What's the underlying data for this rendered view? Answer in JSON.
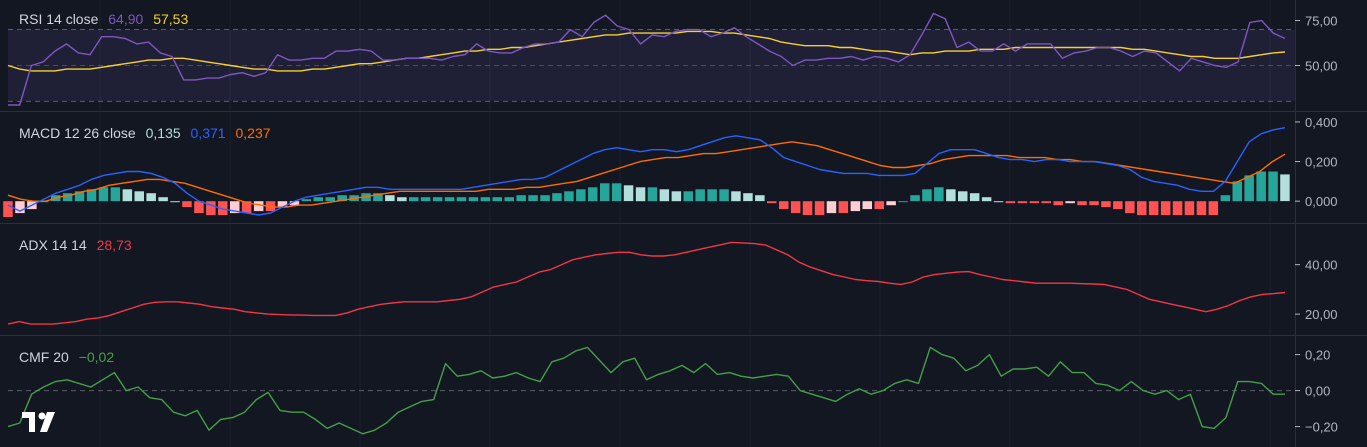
{
  "colors": {
    "background": "#131722",
    "grid": "#1e222d",
    "divider": "#2a2e39",
    "axis_text": "#b2b5be",
    "rsi": "#7e57c2",
    "rsi_ma": "#f5d033",
    "rsi_band": "#7e57c2",
    "macd": "#2962ff",
    "signal": "#ff6d00",
    "hist_pos_strong": "#26a69a",
    "hist_pos_weak": "#b2dfdb",
    "hist_neg_strong": "#ff5252",
    "hist_neg_weak": "#ffcdd2",
    "adx": "#f23645",
    "cmf": "#43a047"
  },
  "logo": {
    "icon": "tradingview-logo-icon"
  },
  "panes": {
    "rsi": {
      "title": "RSI 14 close",
      "value1": "64,90",
      "value2": "57,53"
    },
    "macd": {
      "title": "MACD 12 26 close",
      "hist": "0,135",
      "macd": "0,371",
      "signal": "0,237"
    },
    "adx": {
      "title": "ADX 14 14",
      "value": "28,73"
    },
    "cmf": {
      "title": "CMF 20",
      "value": "−0,02"
    }
  },
  "chart_data": [
    {
      "type": "line",
      "name": "RSI 14 close",
      "yticks": [
        "75,00",
        "50,00"
      ],
      "ytick_values": [
        75,
        50
      ],
      "band": [
        30,
        70
      ],
      "ylim": [
        28,
        82
      ],
      "series": [
        {
          "name": "RSI",
          "values": [
            28,
            28,
            50,
            52,
            58,
            62,
            57,
            56,
            66,
            66,
            65,
            62,
            63,
            57,
            55,
            42,
            42,
            43,
            43,
            45,
            46,
            44,
            46,
            56,
            53,
            53,
            54,
            54,
            58,
            58,
            59,
            58,
            53,
            53,
            54,
            54,
            54,
            53,
            55,
            56,
            62,
            58,
            57,
            57,
            60,
            62,
            62,
            63,
            70,
            66,
            74,
            78,
            72,
            70,
            62,
            67,
            66,
            69,
            70,
            70,
            66,
            68,
            71,
            66,
            62,
            58,
            55,
            50,
            53,
            53,
            54,
            54,
            55,
            53,
            55,
            54,
            52,
            56,
            67,
            79,
            76,
            60,
            63,
            58,
            58,
            62,
            58,
            62,
            62,
            62,
            54,
            57,
            58,
            60,
            60,
            58,
            55,
            58,
            57,
            52,
            47,
            54,
            52,
            50,
            49,
            52,
            74,
            75,
            68,
            65
          ]
        },
        {
          "name": "MA",
          "values": [
            50,
            48,
            47,
            47,
            47,
            48,
            48,
            48,
            49,
            50,
            51,
            52,
            53,
            53,
            54,
            54,
            53,
            52,
            51,
            50,
            49,
            48,
            48,
            47,
            47,
            47,
            48,
            48,
            49,
            50,
            51,
            51,
            52,
            53,
            54,
            54,
            55,
            56,
            57,
            58,
            58,
            59,
            59,
            60,
            60,
            61,
            62,
            63,
            64,
            65,
            66,
            67,
            67,
            68,
            68,
            68,
            68,
            68,
            69,
            69,
            69,
            68,
            68,
            67,
            66,
            65,
            63,
            62,
            61,
            61,
            61,
            60,
            60,
            59,
            58,
            58,
            57,
            56,
            57,
            57,
            58,
            58,
            58,
            59,
            59,
            59,
            60,
            60,
            60,
            60,
            60,
            60,
            60,
            60,
            60,
            60,
            59,
            59,
            58,
            57,
            56,
            55,
            55,
            54,
            54,
            54,
            55,
            56,
            57,
            57.5
          ]
        }
      ]
    },
    {
      "type": "line",
      "name": "MACD 12 26 close",
      "yticks": [
        "0,400",
        "0,200",
        "0,000"
      ],
      "ytick_values": [
        0.4,
        0.2,
        0.0
      ],
      "ylim": [
        -0.08,
        0.42
      ],
      "series": [
        {
          "name": "MACD",
          "values": [
            -0.02,
            -0.05,
            -0.02,
            0.01,
            0.04,
            0.06,
            0.08,
            0.11,
            0.13,
            0.14,
            0.15,
            0.15,
            0.14,
            0.12,
            0.09,
            0.04,
            0.0,
            -0.02,
            -0.04,
            -0.05,
            -0.06,
            -0.07,
            -0.06,
            -0.03,
            0.0,
            0.02,
            0.03,
            0.04,
            0.05,
            0.06,
            0.07,
            0.07,
            0.06,
            0.06,
            0.06,
            0.06,
            0.06,
            0.06,
            0.06,
            0.07,
            0.08,
            0.09,
            0.1,
            0.11,
            0.11,
            0.12,
            0.15,
            0.18,
            0.21,
            0.24,
            0.26,
            0.27,
            0.26,
            0.25,
            0.26,
            0.26,
            0.25,
            0.26,
            0.28,
            0.3,
            0.32,
            0.33,
            0.32,
            0.31,
            0.27,
            0.22,
            0.2,
            0.18,
            0.16,
            0.15,
            0.14,
            0.14,
            0.14,
            0.13,
            0.13,
            0.13,
            0.14,
            0.19,
            0.24,
            0.26,
            0.26,
            0.26,
            0.24,
            0.22,
            0.21,
            0.21,
            0.2,
            0.21,
            0.21,
            0.2,
            0.2,
            0.2,
            0.19,
            0.18,
            0.16,
            0.12,
            0.1,
            0.09,
            0.08,
            0.06,
            0.05,
            0.05,
            0.1,
            0.2,
            0.3,
            0.34,
            0.36,
            0.371
          ]
        },
        {
          "name": "Signal",
          "values": [
            0.03,
            0.01,
            0.0,
            0.0,
            0.02,
            0.03,
            0.05,
            0.06,
            0.08,
            0.09,
            0.1,
            0.11,
            0.11,
            0.1,
            0.09,
            0.07,
            0.05,
            0.03,
            0.01,
            -0.01,
            -0.02,
            -0.03,
            -0.03,
            -0.02,
            -0.02,
            -0.01,
            0.0,
            0.01,
            0.02,
            0.03,
            0.04,
            0.05,
            0.05,
            0.05,
            0.05,
            0.05,
            0.05,
            0.05,
            0.06,
            0.06,
            0.06,
            0.07,
            0.07,
            0.08,
            0.09,
            0.1,
            0.12,
            0.14,
            0.16,
            0.18,
            0.2,
            0.21,
            0.22,
            0.22,
            0.23,
            0.24,
            0.24,
            0.25,
            0.26,
            0.27,
            0.28,
            0.29,
            0.3,
            0.29,
            0.28,
            0.26,
            0.24,
            0.22,
            0.2,
            0.18,
            0.17,
            0.17,
            0.18,
            0.19,
            0.21,
            0.22,
            0.23,
            0.23,
            0.23,
            0.23,
            0.22,
            0.22,
            0.22,
            0.21,
            0.21,
            0.2,
            0.2,
            0.19,
            0.18,
            0.17,
            0.16,
            0.15,
            0.14,
            0.13,
            0.12,
            0.11,
            0.1,
            0.09,
            0.12,
            0.15,
            0.2,
            0.237
          ]
        },
        {
          "name": "Histogram",
          "values": [
            -0.08,
            -0.06,
            -0.04,
            0.0,
            0.03,
            0.04,
            0.05,
            0.06,
            0.07,
            0.07,
            0.06,
            0.05,
            0.04,
            0.02,
            0.0,
            -0.03,
            -0.06,
            -0.07,
            -0.07,
            -0.06,
            -0.06,
            -0.05,
            -0.05,
            -0.03,
            -0.02,
            0.01,
            0.02,
            0.02,
            0.03,
            0.03,
            0.04,
            0.04,
            0.03,
            0.02,
            0.02,
            0.02,
            0.02,
            0.02,
            0.02,
            0.02,
            0.02,
            0.02,
            0.02,
            0.03,
            0.03,
            0.03,
            0.04,
            0.05,
            0.06,
            0.07,
            0.09,
            0.09,
            0.08,
            0.07,
            0.07,
            0.06,
            0.05,
            0.05,
            0.06,
            0.06,
            0.06,
            0.05,
            0.04,
            0.03,
            -0.01,
            -0.04,
            -0.06,
            -0.07,
            -0.07,
            -0.06,
            -0.06,
            -0.05,
            -0.04,
            -0.04,
            -0.02,
            0.0,
            0.03,
            0.06,
            0.07,
            0.06,
            0.05,
            0.04,
            0.02,
            0.0,
            -0.01,
            -0.01,
            -0.01,
            -0.01,
            -0.02,
            -0.01,
            -0.02,
            -0.02,
            -0.03,
            -0.04,
            -0.06,
            -0.07,
            -0.07,
            -0.07,
            -0.07,
            -0.07,
            -0.07,
            -0.07,
            0.03,
            0.1,
            0.13,
            0.15,
            0.15,
            0.135
          ]
        }
      ]
    },
    {
      "type": "line",
      "name": "ADX 14 14",
      "yticks": [
        "40,00",
        "20,00"
      ],
      "ytick_values": [
        40,
        20
      ],
      "ylim": [
        14,
        54
      ],
      "series": [
        {
          "name": "ADX",
          "values": [
            16,
            17,
            16,
            16,
            16,
            16.5,
            17,
            18,
            18.5,
            19.5,
            21,
            22.5,
            24,
            24.8,
            25,
            25,
            24.5,
            24,
            23,
            22.5,
            22,
            21,
            20.5,
            20,
            19.8,
            19.7,
            19.6,
            19.5,
            19.5,
            19.5,
            20.5,
            22,
            23,
            24,
            24.5,
            25,
            25,
            25,
            25,
            25.5,
            26,
            27,
            29,
            31,
            32,
            33,
            35,
            37,
            38,
            40,
            42,
            43,
            44,
            44.5,
            45,
            45,
            44,
            43.5,
            43.5,
            44,
            45,
            46,
            47,
            48,
            49,
            48.8,
            48.5,
            48,
            46,
            44,
            41,
            39,
            37.5,
            36,
            35,
            34,
            33.5,
            33.2,
            32.5,
            32,
            33,
            35,
            36,
            36.5,
            37,
            37.2,
            36,
            35,
            34,
            33.5,
            33,
            32.5,
            32.5,
            32.5,
            32.5,
            32.3,
            32.2,
            32,
            31,
            30,
            28,
            26,
            25,
            24,
            23,
            22,
            21,
            22,
            23.5,
            25.5,
            27,
            28,
            28.3,
            28.73
          ]
        }
      ]
    },
    {
      "type": "line",
      "name": "CMF 20",
      "yticks": [
        "0,20",
        "0,00",
        "−0,20"
      ],
      "ytick_values": [
        0.2,
        0.0,
        -0.2
      ],
      "ylim": [
        -0.28,
        0.27
      ],
      "series": [
        {
          "name": "CMF",
          "values": [
            -0.2,
            -0.18,
            -0.02,
            0.02,
            0.05,
            0.06,
            0.04,
            0.02,
            0.06,
            0.1,
            0.0,
            0.02,
            -0.04,
            -0.05,
            -0.12,
            -0.14,
            -0.11,
            -0.22,
            -0.16,
            -0.15,
            -0.12,
            -0.05,
            -0.01,
            -0.11,
            -0.12,
            -0.12,
            -0.16,
            -0.21,
            -0.18,
            -0.21,
            -0.24,
            -0.22,
            -0.18,
            -0.12,
            -0.09,
            -0.06,
            -0.05,
            0.15,
            0.08,
            0.09,
            0.11,
            0.07,
            0.08,
            0.1,
            0.07,
            0.05,
            0.16,
            0.18,
            0.22,
            0.24,
            0.17,
            0.1,
            0.16,
            0.18,
            0.06,
            0.09,
            0.11,
            0.14,
            0.1,
            0.15,
            0.09,
            0.1,
            0.08,
            0.07,
            0.08,
            0.09,
            0.08,
            0.0,
            -0.02,
            -0.04,
            -0.06,
            -0.02,
            0.01,
            -0.02,
            0.0,
            0.04,
            0.06,
            0.04,
            0.24,
            0.2,
            0.18,
            0.11,
            0.14,
            0.2,
            0.08,
            0.12,
            0.12,
            0.13,
            0.08,
            0.16,
            0.1,
            0.1,
            0.04,
            0.03,
            0.0,
            0.05,
            0.0,
            -0.02,
            0.0,
            -0.05,
            -0.02,
            -0.2,
            -0.21,
            -0.15,
            0.05,
            0.05,
            0.04,
            -0.02,
            -0.02
          ]
        }
      ]
    }
  ]
}
